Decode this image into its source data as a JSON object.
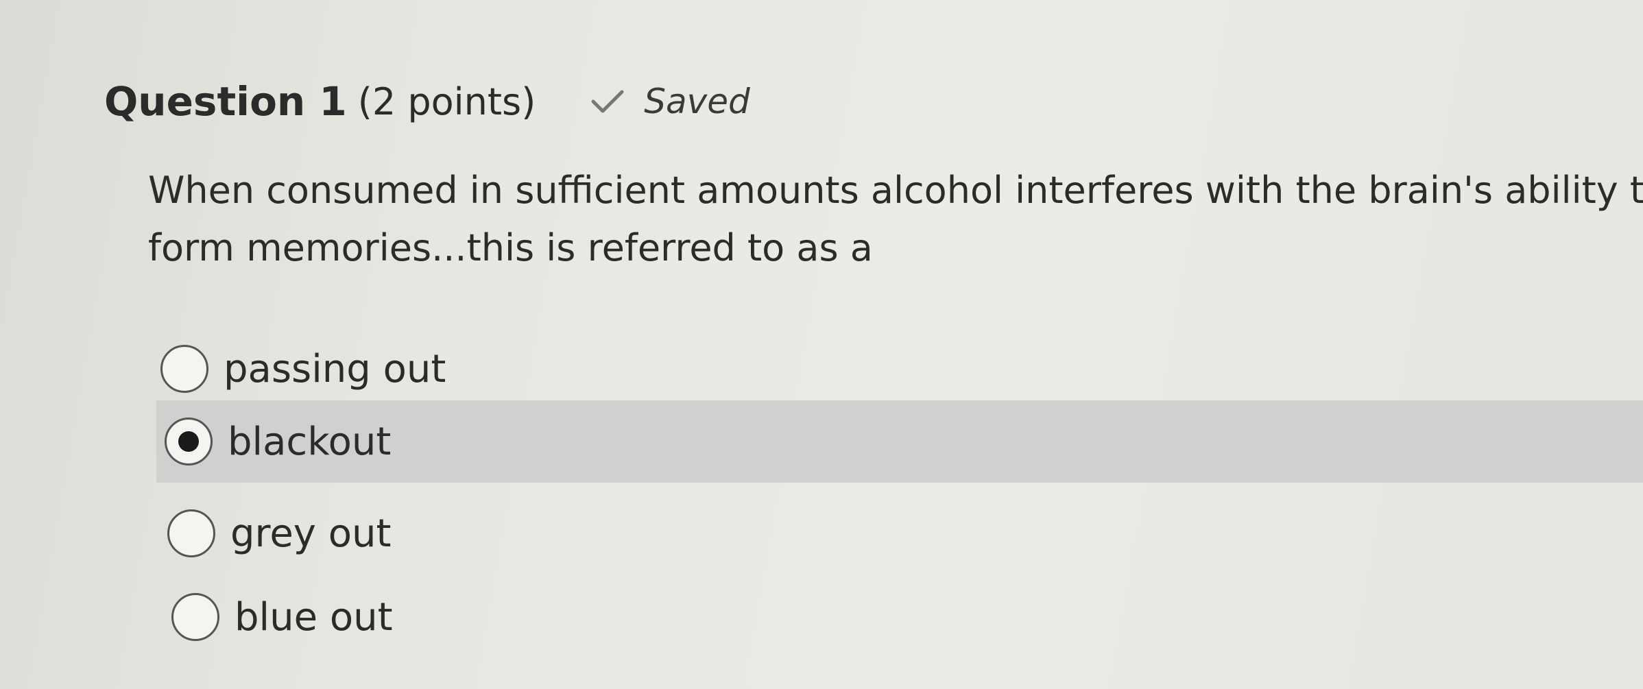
{
  "question": {
    "title": "Question 1",
    "points": "(2 points)",
    "status": "Saved",
    "status_icon": "check-icon",
    "text_line1": "When consumed in sufficient amounts alcohol interferes with the brain's ability to",
    "text_line2": "form memories...this is referred to as a"
  },
  "options": [
    {
      "label": "passing out",
      "selected": false
    },
    {
      "label": "blackout",
      "selected": true
    },
    {
      "label": "grey out",
      "selected": false
    },
    {
      "label": "blue out",
      "selected": false
    }
  ],
  "colors": {
    "selected_row": "#cfd1cf",
    "background": "#e8e8e2"
  }
}
